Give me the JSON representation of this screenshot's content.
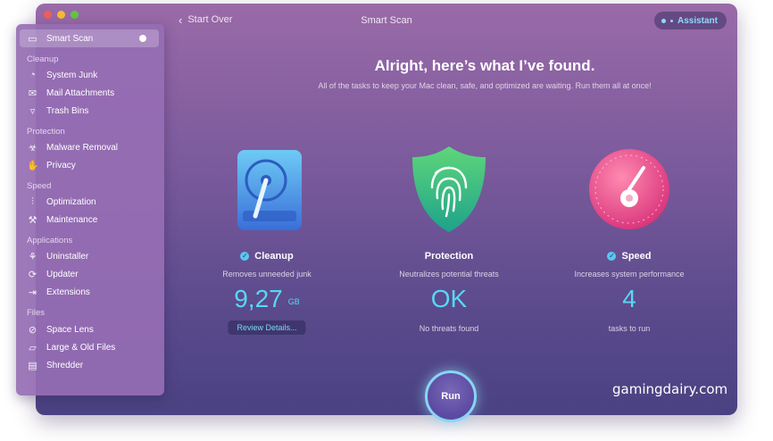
{
  "window": {
    "title": "Smart Scan",
    "back_label": "Start Over",
    "assistant_label": "Assistant"
  },
  "sidebar": {
    "top_item": "Smart Scan",
    "sections": [
      {
        "label": "Cleanup",
        "items": [
          "System Junk",
          "Mail Attachments",
          "Trash Bins"
        ]
      },
      {
        "label": "Protection",
        "items": [
          "Malware Removal",
          "Privacy"
        ]
      },
      {
        "label": "Speed",
        "items": [
          "Optimization",
          "Maintenance"
        ]
      },
      {
        "label": "Applications",
        "items": [
          "Uninstaller",
          "Updater",
          "Extensions"
        ]
      },
      {
        "label": "Files",
        "items": [
          "Space Lens",
          "Large & Old Files",
          "Shredder"
        ]
      }
    ]
  },
  "main": {
    "heading": "Alright, here’s what I’ve found.",
    "subheading": "All of the tasks to keep your Mac clean, safe, and optimized are waiting. Run them all at once!",
    "cleanup": {
      "title": "Cleanup",
      "desc": "Removes unneeded junk",
      "value": "9,27",
      "unit": "GB",
      "button": "Review Details..."
    },
    "protection": {
      "title": "Protection",
      "desc": "Neutralizes potential threats",
      "value": "OK",
      "foot": "No threats found"
    },
    "speed": {
      "title": "Speed",
      "desc": "Increases system performance",
      "value": "4",
      "foot": "tasks to run"
    },
    "run_label": "Run"
  },
  "watermark": "gamingdairy.com",
  "colors": {
    "accent": "#58d8f2",
    "background_top": "#9a6aa8",
    "background_bottom": "#4a4282"
  }
}
